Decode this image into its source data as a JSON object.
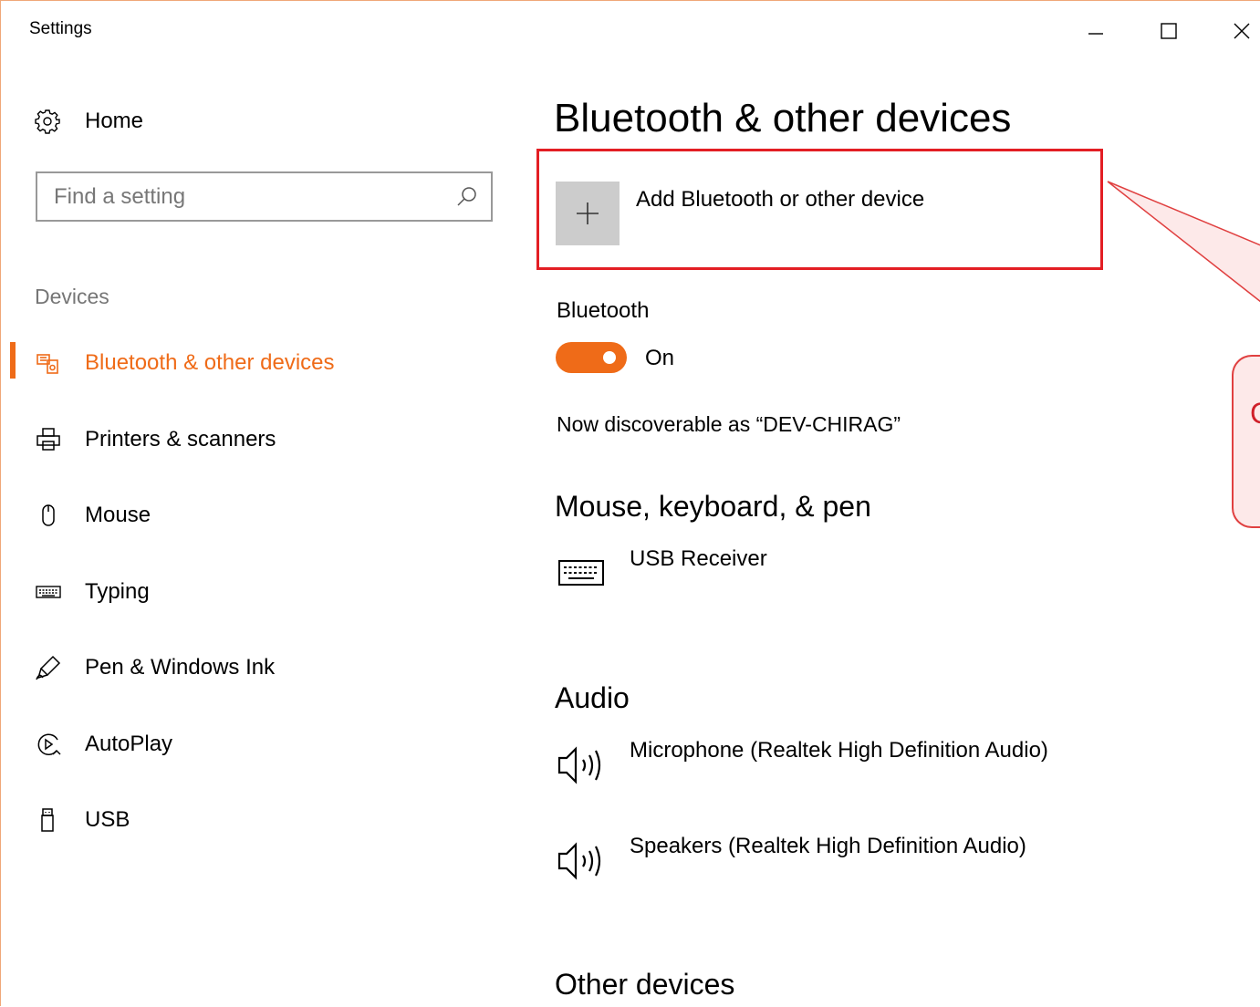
{
  "window": {
    "title": "Settings",
    "controls": {
      "minimize": "minimize-icon",
      "maximize": "maximize-icon",
      "close": "close-icon"
    }
  },
  "sidebar": {
    "home_label": "Home",
    "search": {
      "placeholder": "Find a setting",
      "value": ""
    },
    "section_label": "Devices",
    "items": [
      {
        "label": "Bluetooth & other devices",
        "icon": "bluetooth-devices-icon",
        "active": true
      },
      {
        "label": "Printers & scanners",
        "icon": "printer-icon",
        "active": false
      },
      {
        "label": "Mouse",
        "icon": "mouse-icon",
        "active": false
      },
      {
        "label": "Typing",
        "icon": "keyboard-icon",
        "active": false
      },
      {
        "label": "Pen & Windows Ink",
        "icon": "pen-icon",
        "active": false
      },
      {
        "label": "AutoPlay",
        "icon": "autoplay-icon",
        "active": false
      },
      {
        "label": "USB",
        "icon": "usb-icon",
        "active": false
      }
    ]
  },
  "main": {
    "title": "Bluetooth & other devices",
    "add_device_label": "Add Bluetooth or other device",
    "bluetooth": {
      "label": "Bluetooth",
      "toggle_state": "On",
      "enabled": true,
      "discoverable_text": "Now discoverable as “DEV-CHIRAG”"
    },
    "sections": [
      {
        "heading": "Mouse, keyboard, & pen",
        "devices": [
          {
            "name": "USB Receiver",
            "icon": "keyboard-icon"
          }
        ]
      },
      {
        "heading": "Audio",
        "devices": [
          {
            "name": "Microphone (Realtek High Definition Audio)",
            "icon": "speaker-icon"
          },
          {
            "name": "Speakers (Realtek High Definition Audio)",
            "icon": "speaker-icon"
          }
        ]
      },
      {
        "heading": "Other devices",
        "devices": []
      }
    ]
  },
  "annotation": {
    "callout_text": "C"
  },
  "colors": {
    "accent": "#ef6b18",
    "highlight": "#e31e24",
    "callout_fill": "#fde9e9"
  }
}
